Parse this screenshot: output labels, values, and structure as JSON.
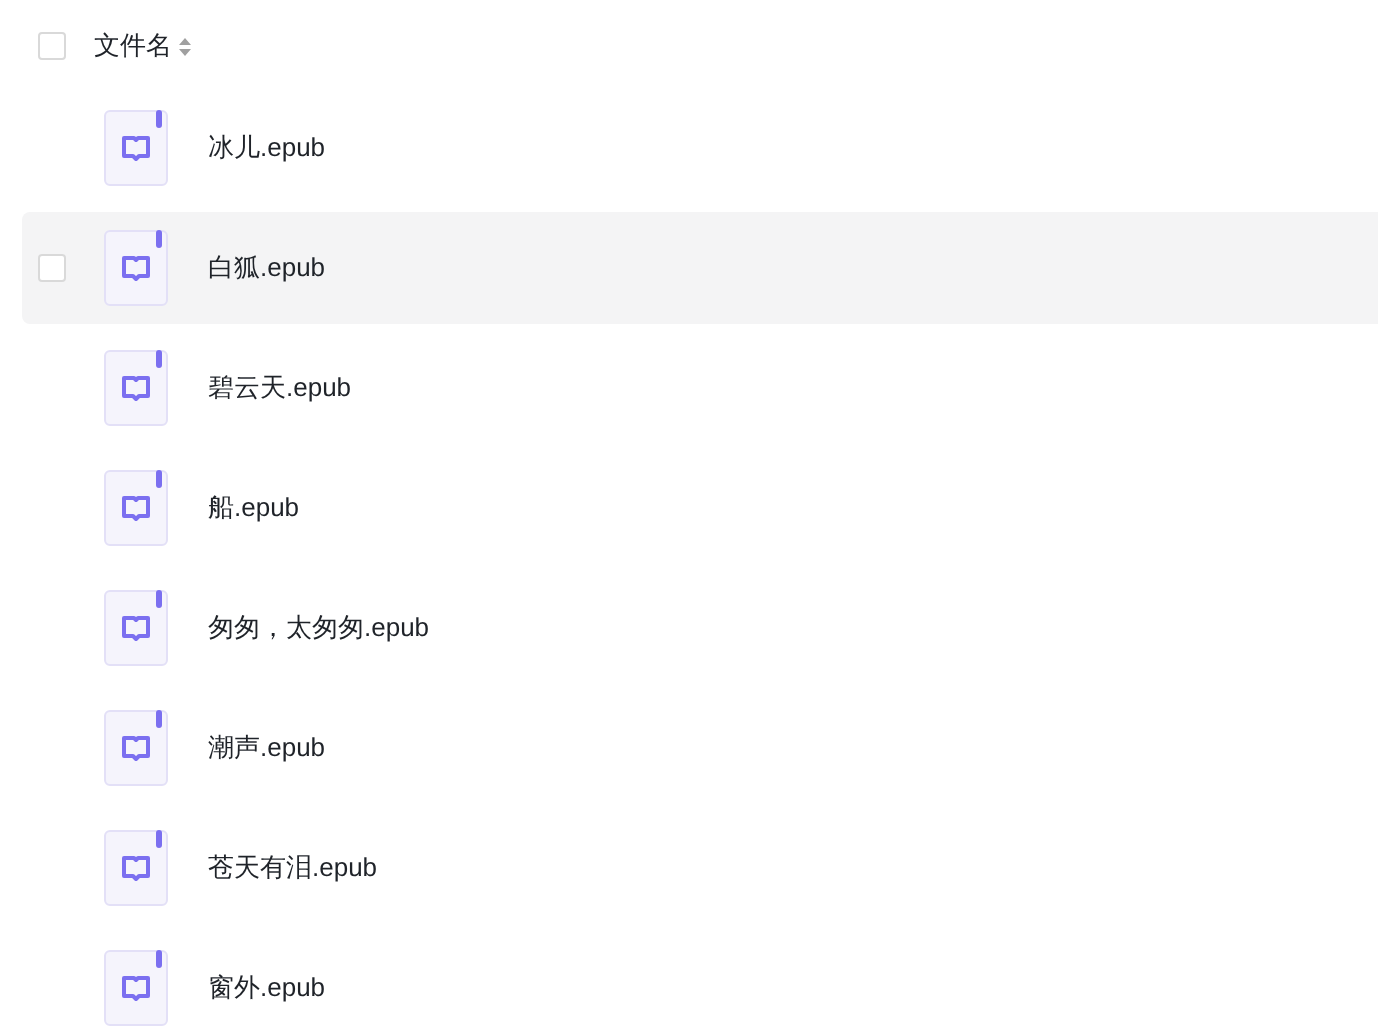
{
  "header": {
    "label": "文件名",
    "checked": false
  },
  "files": [
    {
      "name": "冰儿.epub",
      "hovered": false
    },
    {
      "name": "白狐.epub",
      "hovered": true
    },
    {
      "name": "碧云天.epub",
      "hovered": false
    },
    {
      "name": "船.epub",
      "hovered": false
    },
    {
      "name": "匆匆，太匆匆.epub",
      "hovered": false
    },
    {
      "name": "潮声.epub",
      "hovered": false
    },
    {
      "name": "苍天有泪.epub",
      "hovered": false
    },
    {
      "name": "窗外.epub",
      "hovered": false
    }
  ]
}
